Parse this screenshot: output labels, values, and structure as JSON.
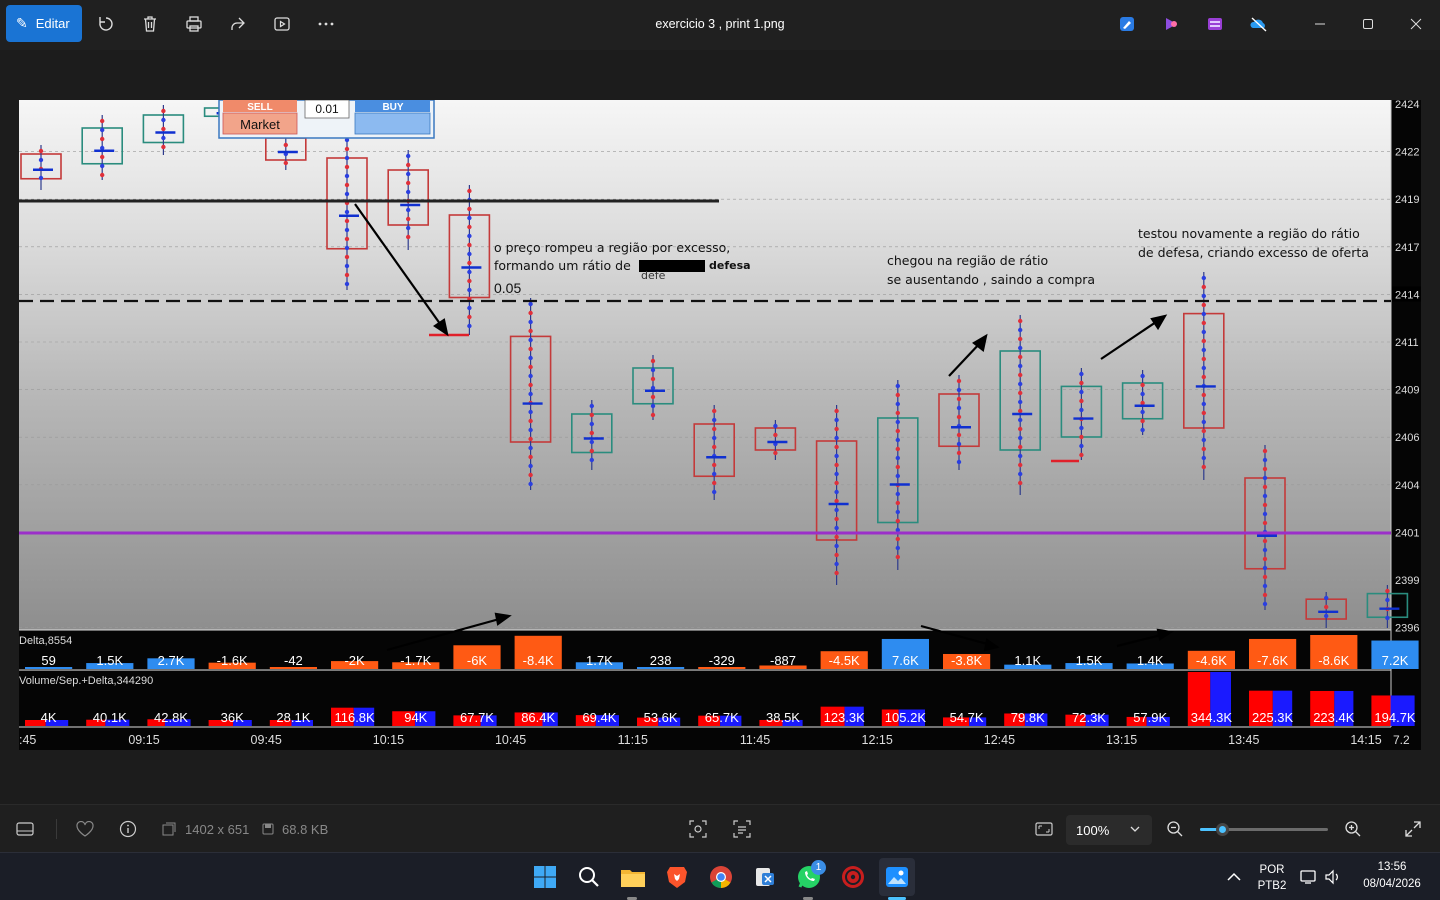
{
  "titlebar": {
    "edit_label": "Editar",
    "title": "exercicio 3 , print 1.png",
    "tools": [
      "rotate-icon",
      "trash-icon",
      "print-icon",
      "share-icon",
      "slideshow-icon",
      "more-icon"
    ],
    "apps": [
      "paint-icon",
      "clipchamp-icon",
      "video-editor-icon",
      "onedrive-icon"
    ]
  },
  "chart": {
    "order_panel": {
      "sell": "SELL",
      "qty": "0.01",
      "buy": "BUY",
      "market": "Market"
    },
    "price_ticks": [
      "2424",
      "2422",
      "2419",
      "2417",
      "2414",
      "2411",
      "2409",
      "2406",
      "2404",
      "2401",
      "2399",
      "2396"
    ],
    "current_price_label": "2414",
    "annotations": {
      "a1_line1": "o preço rompeu a região por excesso,",
      "a1_line2": "formando um rátio de",
      "a1_hidden": "defesa",
      "a1_under": "defe",
      "a1_value": "0.05",
      "a2_line1": "chegou na região de rátio",
      "a2_line2": "se ausentando , saindo a compra",
      "a3_line1": "testou novamente a região do rátio",
      "a3_line2": "de defesa, criando excesso de oferta"
    },
    "delta_title": "Delta,8554",
    "delta_values": [
      "59",
      "1.5K",
      "2.7K",
      "-1.6K",
      "-42",
      "-2K",
      "-1.7K",
      "-6K",
      "-8.4K",
      "1.7K",
      "238",
      "-329",
      "-887",
      "-4.5K",
      "7.6K",
      "-3.8K",
      "1.1K",
      "1.5K",
      "1.4K",
      "-4.6K",
      "-7.6K",
      "-8.6K",
      "7.2K"
    ],
    "delta_numeric": [
      59,
      1500,
      2700,
      -1600,
      -42,
      -2000,
      -1700,
      -6000,
      -8400,
      1700,
      238,
      -329,
      -887,
      -4500,
      7600,
      -3800,
      1100,
      1500,
      1400,
      -4600,
      -7600,
      -8600,
      7200
    ],
    "volume_title": "Volume/Sep.+Delta,344290",
    "volume_values": [
      "4K",
      "40.1K",
      "42.8K",
      "36K",
      "28.1K",
      "116.8K",
      "94K",
      "67.7K",
      "86.4K",
      "69.4K",
      "53.6K",
      "65.7K",
      "38.5K",
      "123.3K",
      "105.2K",
      "54.7K",
      "79.8K",
      "72.3K",
      "57.9K",
      "344.3K",
      "225.3K",
      "223.4K",
      "194.7K"
    ],
    "volume_numeric": [
      4000,
      40100,
      42800,
      36000,
      28100,
      116800,
      94000,
      67700,
      86400,
      69400,
      53600,
      65700,
      38500,
      123300,
      105200,
      54700,
      79800,
      72300,
      57900,
      344300,
      225300,
      223400,
      194700
    ],
    "time_labels": [
      ":45",
      "09:15",
      "09:45",
      "10:15",
      "10:45",
      "11:15",
      "11:45",
      "12:15",
      "12:45",
      "13:15",
      "13:45",
      "14:15"
    ],
    "right_edge_label": "7.2",
    "colors": {
      "bull": "#2a8c7e",
      "bear": "#c43a3a",
      "pos_bar": "#2e8cf0",
      "neg_bar": "#ff5a14",
      "purple_line": "#9b2fc9"
    }
  },
  "bottombar": {
    "dimensions": "1402 x 651",
    "filesize": "68.8 KB",
    "zoom": "100%",
    "zoom_fraction": 0.17
  },
  "taskbar": {
    "apps": [
      "windows-start-icon",
      "search-icon",
      "file-explorer-icon",
      "brave-icon",
      "chrome-icon",
      "snipping-tool-icon",
      "whatsapp-icon",
      "davinci-icon",
      "photos-icon"
    ],
    "whatsapp_badge": "1",
    "lang_top": "POR",
    "lang_bottom": "PTB2",
    "time": "13:56",
    "date": "08/04/2026"
  }
}
